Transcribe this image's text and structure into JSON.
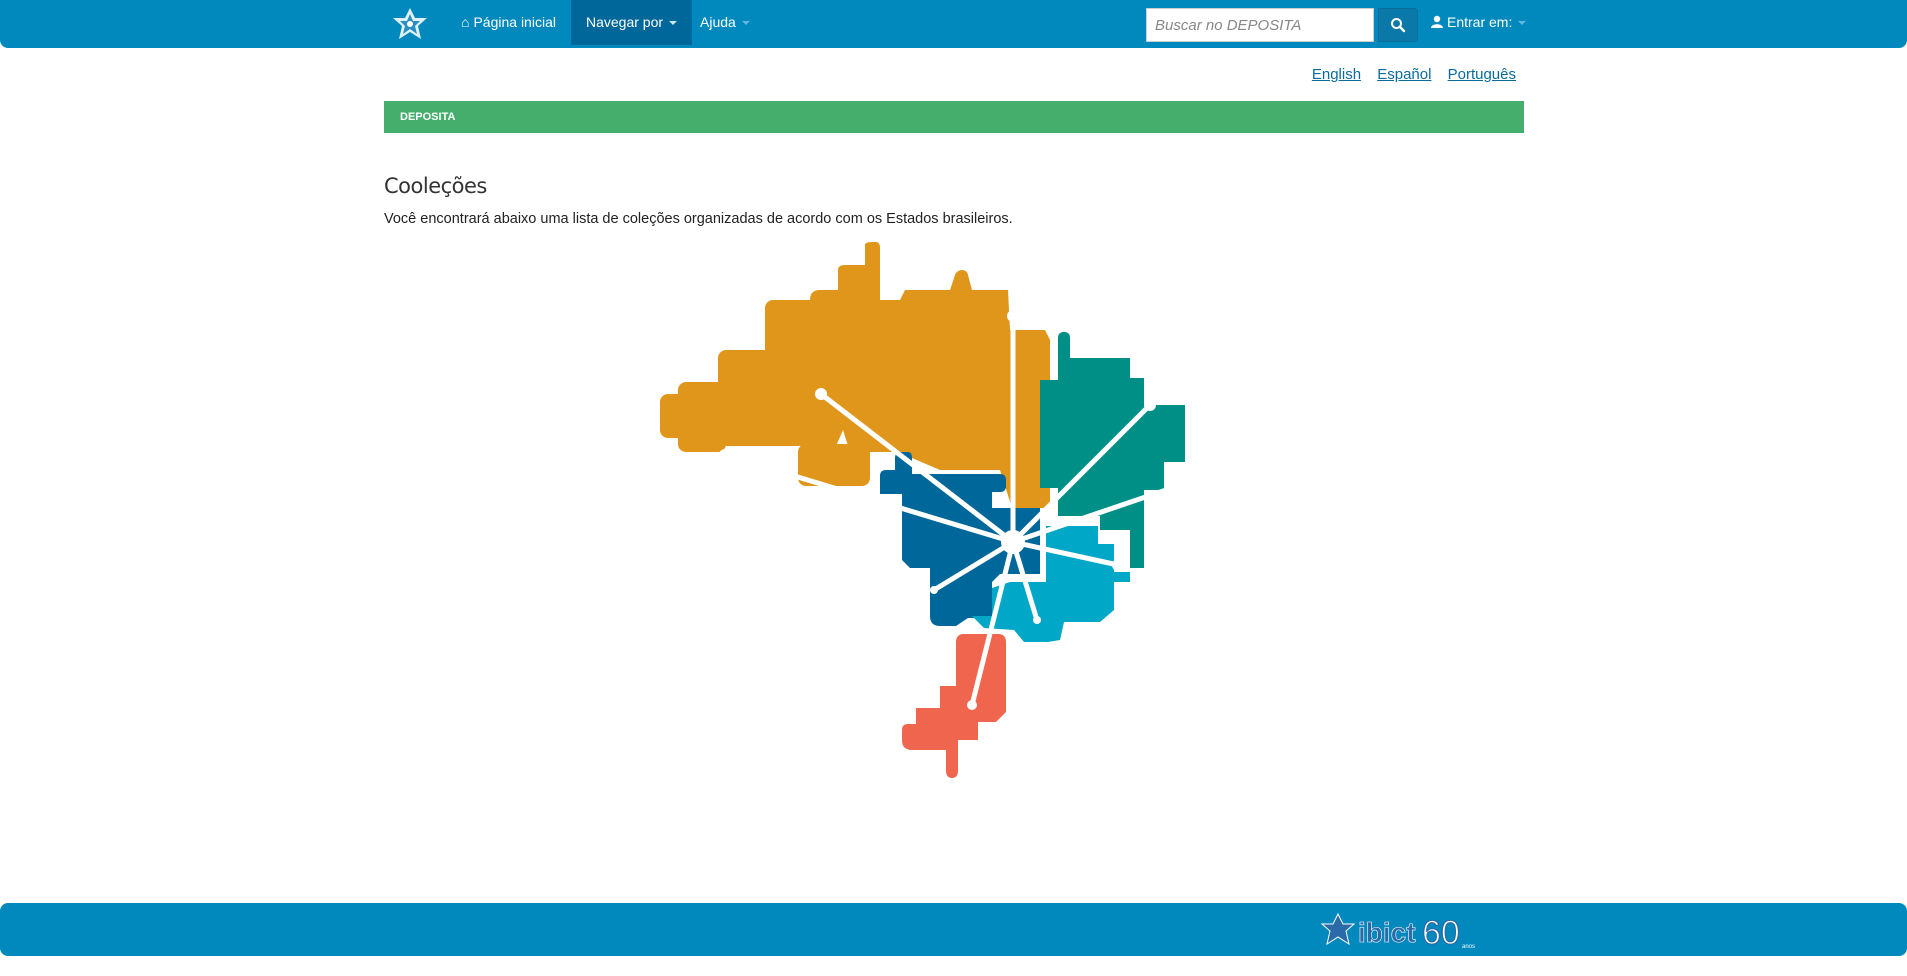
{
  "nav": {
    "home_label": "Página inicial",
    "browse_label": "Navegar por",
    "help_label": "Ajuda",
    "search_placeholder": "Buscar no DEPOSITA",
    "login_label": "Entrar em:"
  },
  "languages": [
    "English",
    "Español",
    "Português"
  ],
  "breadcrumb": "DEPOSITA",
  "page": {
    "title": "Cooleções",
    "intro": "Você encontrará abaixo uma lista de coleções organizadas de acordo com os Estados brasileiros."
  },
  "footer": {
    "logo_text": "ibict",
    "logo_number": "60",
    "logo_sub": "anos"
  },
  "colors": {
    "nav": "#0189bd",
    "trail": "#45ae6c",
    "north": "#e0961a",
    "northeast": "#008f87",
    "midwest": "#00679a",
    "southeast": "#00a7c6",
    "south": "#f0654d"
  }
}
